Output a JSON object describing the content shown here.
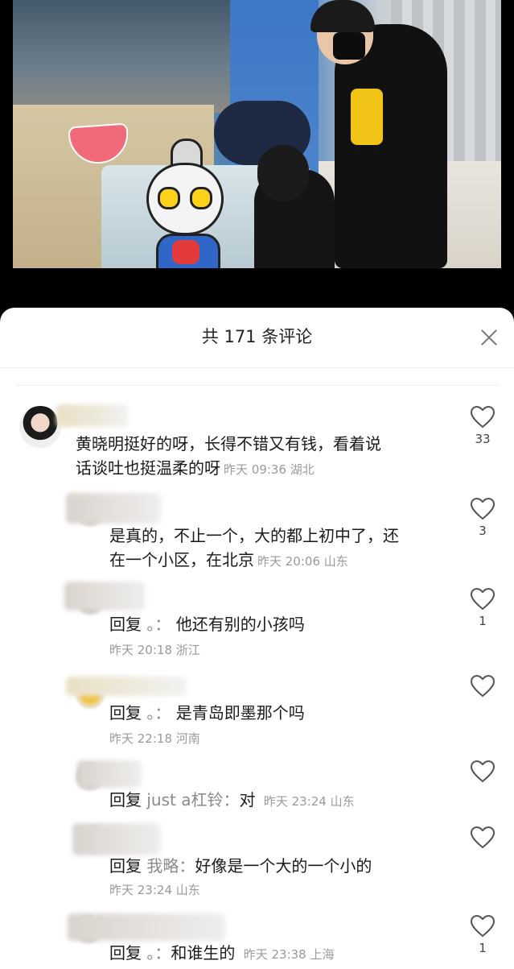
{
  "sheet": {
    "title": "共 171 条评论"
  },
  "comments": [
    {
      "text_line1": "黄晓明挺好的呀，长得不错又有钱，看着说",
      "text_line2": "话谈吐也挺温柔的呀",
      "meta": "昨天 09:36 湖北",
      "likes": "33"
    },
    {
      "text_line1": "是真的，不止一个，大的都上初中了，还",
      "text_line2": "在一个小区，在北京",
      "meta": "昨天 20:06 山东",
      "likes": "3"
    },
    {
      "reply_word": "回复",
      "reply_target": "。：",
      "text": "他还有别的小孩吗",
      "meta": "昨天 20:18 浙江",
      "likes": "1"
    },
    {
      "reply_word": "回复",
      "reply_target": "。：",
      "text": "是青岛即墨那个吗",
      "meta": "昨天 22:18 河南",
      "likes": ""
    },
    {
      "reply_word": "回复",
      "reply_target": "just a杠铃：",
      "text": "对",
      "meta": "昨天 23:24 山东",
      "likes": ""
    },
    {
      "reply_word": "回复",
      "reply_target": "我略：",
      "text": "好像是一个大的一个小的",
      "meta": "昨天 23:24 山东",
      "likes": ""
    },
    {
      "reply_word": "回复",
      "reply_target": "。：",
      "text": "和谁生的",
      "meta": "昨天 23:38 上海",
      "likes": "1"
    }
  ],
  "icons": {
    "like": "heart-outline-icon",
    "close": "close-icon"
  },
  "colors": {
    "text": "#1a1a1a",
    "meta": "#9a9a9a",
    "icon": "#555555"
  }
}
